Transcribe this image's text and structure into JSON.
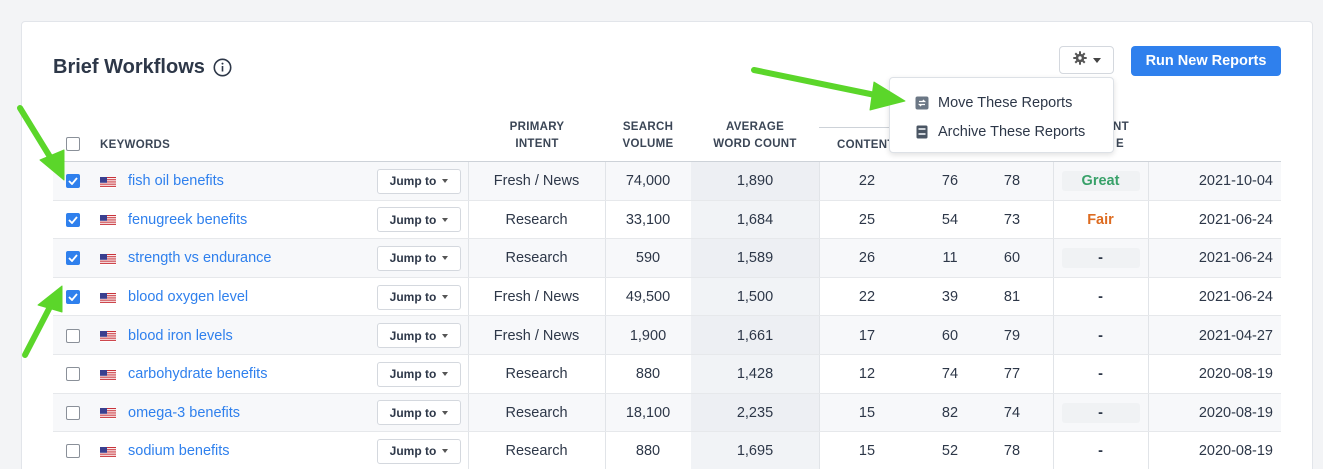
{
  "title": "Brief Workflows",
  "run_button": "Run New Reports",
  "menu": [
    {
      "label": "Move These Reports",
      "icon": "move-icon"
    },
    {
      "label": "Archive These Reports",
      "icon": "archive-icon"
    }
  ],
  "headers": {
    "keywords": "KEYWORDS",
    "primary_intent_1": "PRIMARY",
    "primary_intent_2": "INTENT",
    "search_volume_1": "SEARCH",
    "search_volume_2": "VOLUME",
    "avg_word_count_1": "AVERAGE",
    "avg_word_count_2": "WORD COUNT",
    "content": "CONTENT",
    "partial_1": "NT",
    "partial_2": "E"
  },
  "jump_label": "Jump to",
  "colors": {
    "accent": "#2f80ed",
    "great": "#38a169",
    "fair": "#dd6b20"
  },
  "rows": [
    {
      "checked": true,
      "keyword": "fish oil benefits",
      "intent": "Fresh / News",
      "volume": "74,000",
      "wordcount": "1,890",
      "c1": "22",
      "c2": "76",
      "c3": "78",
      "grade": "Great",
      "grade_box": true,
      "date": "2021-10-04"
    },
    {
      "checked": true,
      "keyword": "fenugreek benefits",
      "intent": "Research",
      "volume": "33,100",
      "wordcount": "1,684",
      "c1": "25",
      "c2": "54",
      "c3": "73",
      "grade": "Fair",
      "grade_box": false,
      "date": "2021-06-24"
    },
    {
      "checked": true,
      "keyword": "strength vs endurance",
      "intent": "Research",
      "volume": "590",
      "wordcount": "1,589",
      "c1": "26",
      "c2": "11",
      "c3": "60",
      "grade": "-",
      "grade_box": true,
      "date": "2021-06-24"
    },
    {
      "checked": true,
      "keyword": "blood oxygen level",
      "intent": "Fresh / News",
      "volume": "49,500",
      "wordcount": "1,500",
      "c1": "22",
      "c2": "39",
      "c3": "81",
      "grade": "-",
      "grade_box": false,
      "date": "2021-06-24"
    },
    {
      "checked": false,
      "keyword": "blood iron levels",
      "intent": "Fresh / News",
      "volume": "1,900",
      "wordcount": "1,661",
      "c1": "17",
      "c2": "60",
      "c3": "79",
      "grade": "-",
      "grade_box": false,
      "date": "2021-04-27"
    },
    {
      "checked": false,
      "keyword": "carbohydrate benefits",
      "intent": "Research",
      "volume": "880",
      "wordcount": "1,428",
      "c1": "12",
      "c2": "74",
      "c3": "77",
      "grade": "-",
      "grade_box": false,
      "date": "2020-08-19"
    },
    {
      "checked": false,
      "keyword": "omega-3 benefits",
      "intent": "Research",
      "volume": "18,100",
      "wordcount": "2,235",
      "c1": "15",
      "c2": "82",
      "c3": "74",
      "grade": "-",
      "grade_box": true,
      "date": "2020-08-19"
    },
    {
      "checked": false,
      "keyword": "sodium benefits",
      "intent": "Research",
      "volume": "880",
      "wordcount": "1,695",
      "c1": "15",
      "c2": "52",
      "c3": "78",
      "grade": "-",
      "grade_box": false,
      "date": "2020-08-19"
    }
  ]
}
